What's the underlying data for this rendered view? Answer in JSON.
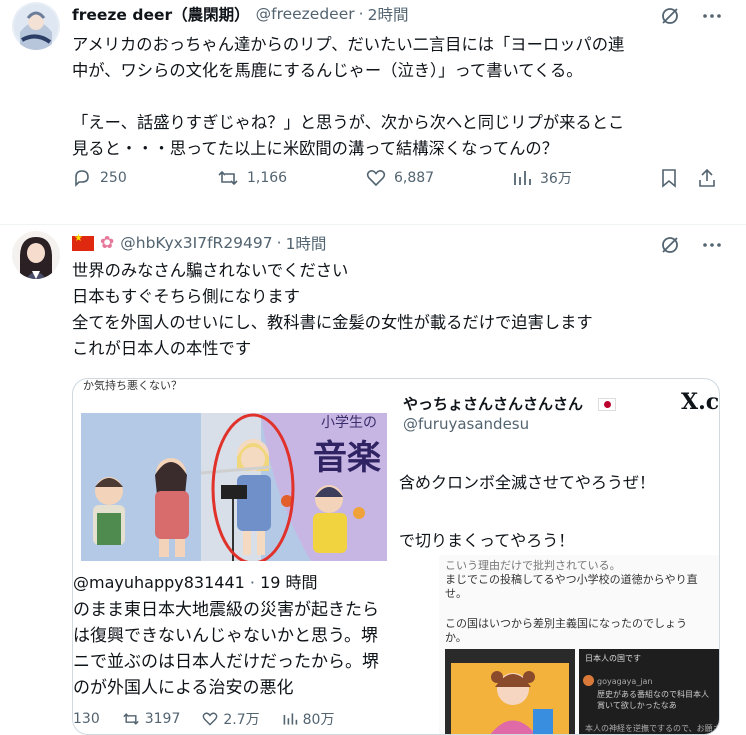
{
  "tweet1": {
    "display_name": "freeze deer（農閑期）",
    "handle": "@freezedeer",
    "separator": "·",
    "time": "2時間",
    "lines": [
      "アメリカのおっちゃん達からのリプ、だいたい二言目には「ヨーロッパの連",
      "中が、ワシらの文化を馬鹿にするんじゃー（泣き）」って書いてくる。",
      "",
      "「えー、話盛りすぎじゃね？」と思うが、次から次へと同じリプが来るとこ",
      "見ると・・・思ってた以上に米欧間の溝って結構深くなってんの？"
    ],
    "replies": "250",
    "retweets": "1,166",
    "likes": "6,887",
    "views": "36万"
  },
  "tweet2": {
    "handle": "@hbKyx3I7fR29497",
    "separator": "·",
    "time": "1時間",
    "lines": [
      "世界のみなさん騙されないでください",
      "日本もすぐそちら側になります",
      "全てを外国人のせいにし、教科書に金髪の女性が載るだけで迫害します",
      "これが日本人の本性です"
    ]
  },
  "embed_left": {
    "caption": "か気持ち悪くない？",
    "sign_text": "小学生の",
    "music_text": "音楽",
    "handle": "@mayuhappy831441",
    "separator": "·",
    "time": "19 時間",
    "lines": [
      "のまま東日本大地震級の災害が起きたら",
      "は復興できないんじゃないかと思う。堺",
      "ニで並ぶのは日本人だけだったから。堺",
      "のが外国人による治安の悪化"
    ],
    "replies": "130",
    "retweets": "3197",
    "likes": "2.7万",
    "views": "80万"
  },
  "embed_right": {
    "name": "やっちょさんさんさんさん",
    "handle": "@furuyasandesu",
    "logo": "X.c",
    "line1": "含めクロンボ全滅させてやろうぜ！",
    "line2": "で切りまくってやろう！",
    "small_lines": [
      "こいう理由だけで批判されている。",
      "まじでこの投稿してるやつ小学校の道徳からやり直",
      "せ。",
      "この国はいつから差別主義国になったのでしょう",
      "か。"
    ],
    "mini_name": "日本人の国です",
    "mini_handle": "goyagaya_jan",
    "mini_text": "歴史がある番組なので科目本人賞いて欲しかったなあ",
    "mini_text2": "本人の神経を逆撫でするので、お願さんみ"
  },
  "colors": {
    "accent_red": "#e0312b",
    "secondary_text": "#536471",
    "border": "#cfd9de"
  }
}
